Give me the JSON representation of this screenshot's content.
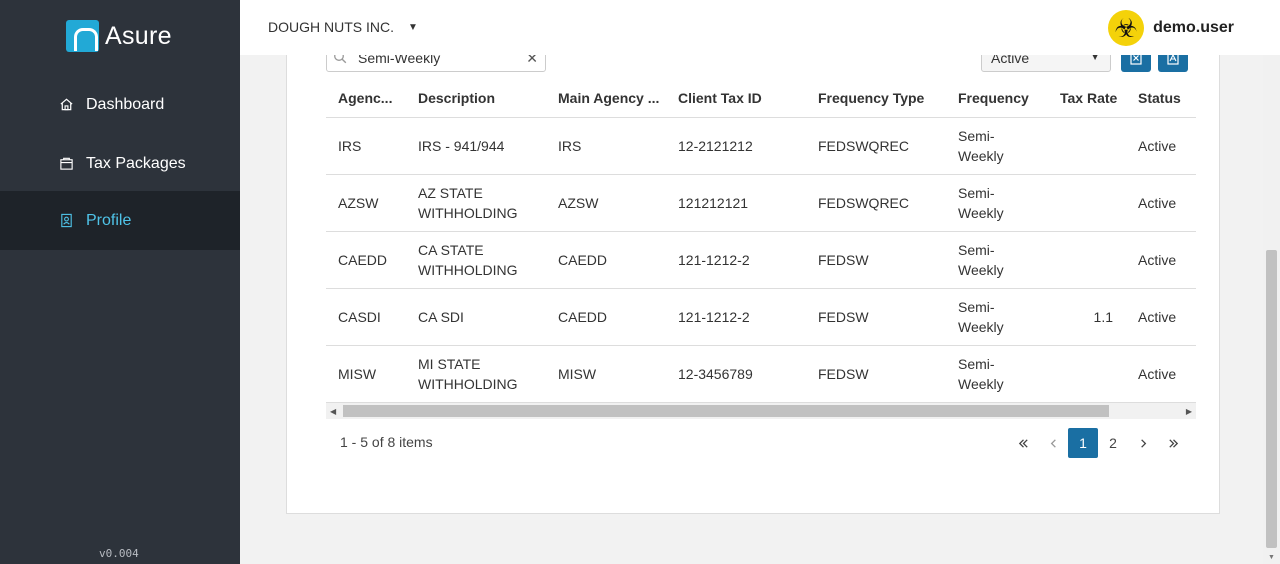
{
  "brand": {
    "name": "Asure"
  },
  "sidebar": {
    "items": [
      {
        "label": "Dashboard",
        "icon": "home-icon",
        "active": false
      },
      {
        "label": "Tax Packages",
        "icon": "package-icon",
        "active": false
      },
      {
        "label": "Profile",
        "icon": "profile-icon",
        "active": true
      }
    ],
    "version": "v0.004"
  },
  "header": {
    "company": "DOUGH NUTS INC.",
    "username": "demo.user",
    "avatar_icon": "biohazard-icon"
  },
  "filters": {
    "search_value": "Semi-Weekly",
    "status_value": "Active"
  },
  "table": {
    "columns": [
      "Agenc...",
      "Description",
      "Main Agency ...",
      "Client Tax ID",
      "Frequency Type",
      "Frequency",
      "Tax Rate",
      "Status"
    ],
    "rows": [
      {
        "agency": "IRS",
        "description": "IRS - 941/944",
        "main_agency": "IRS",
        "client_tax_id": "12-2121212",
        "frequency_type": "FEDSWQREC",
        "frequency": "Semi-Weekly",
        "tax_rate": "",
        "status": "Active"
      },
      {
        "agency": "AZSW",
        "description": "AZ STATE WITHHOLDING",
        "main_agency": "AZSW",
        "client_tax_id": "121212121",
        "frequency_type": "FEDSWQREC",
        "frequency": "Semi-Weekly",
        "tax_rate": "",
        "status": "Active"
      },
      {
        "agency": "CAEDD",
        "description": "CA STATE WITHHOLDING",
        "main_agency": "CAEDD",
        "client_tax_id": "121-1212-2",
        "frequency_type": "FEDSW",
        "frequency": "Semi-Weekly",
        "tax_rate": "",
        "status": "Active"
      },
      {
        "agency": "CASDI",
        "description": "CA SDI",
        "main_agency": "CAEDD",
        "client_tax_id": "121-1212-2",
        "frequency_type": "FEDSW",
        "frequency": "Semi-Weekly",
        "tax_rate": "1.1",
        "status": "Active"
      },
      {
        "agency": "MISW",
        "description": "MI STATE WITHHOLDING",
        "main_agency": "MISW",
        "client_tax_id": "12-3456789",
        "frequency_type": "FEDSW",
        "frequency": "Semi-Weekly",
        "tax_rate": "",
        "status": "Active"
      }
    ]
  },
  "pager": {
    "info": "1 - 5 of 8 items",
    "pages": [
      "1",
      "2"
    ],
    "current": "1"
  },
  "colors": {
    "sidebar_bg": "#2d333b",
    "active_nav_text": "#4fc3e8",
    "primary_button": "#1a6fa3",
    "avatar_bg": "#f4d20a"
  }
}
